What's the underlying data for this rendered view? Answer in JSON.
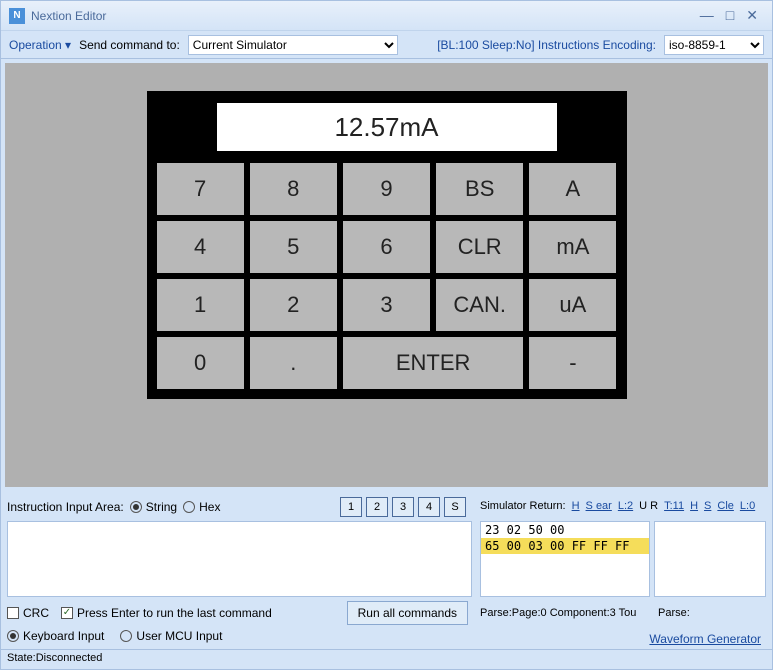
{
  "window": {
    "title": "Nextion Editor",
    "icon_text": "N"
  },
  "toolbar": {
    "operation": "Operation",
    "send_to_label": "Send command to:",
    "send_to_value": "Current Simulator",
    "bracket_info": "[BL:100 Sleep:No] Instructions Encoding:",
    "encoding_value": "iso-8859-1"
  },
  "calc": {
    "display": "12.57mA",
    "keys_row1": [
      "7",
      "8",
      "9",
      "BS",
      "A"
    ],
    "keys_row2": [
      "4",
      "5",
      "6",
      "CLR",
      "mA"
    ],
    "keys_row3": [
      "1",
      "2",
      "3",
      "CAN.",
      "uA"
    ],
    "keys_row4": [
      "0",
      ".",
      "ENTER",
      "-"
    ]
  },
  "input": {
    "label": "Instruction Input Area:",
    "radio_string": "String",
    "radio_hex": "Hex",
    "selected_radio": "string",
    "num_buttons": [
      "1",
      "2",
      "3",
      "4",
      "S"
    ],
    "textarea_value": ""
  },
  "return_panel": {
    "label": "Simulator Return:",
    "links": [
      "H",
      "S ear",
      "L:2",
      "U R",
      "T:11",
      "H",
      "S",
      "Cle",
      "L:0"
    ],
    "lines": [
      "23 02 50 00",
      "65 00 03 00 FF FF FF"
    ],
    "highlight_index": 1,
    "parse_a": "Parse:Page:0 Component:3 Tou",
    "parse_b": "Parse:"
  },
  "options": {
    "crc_label": "CRC",
    "press_enter_label": "Press Enter to run the last command",
    "crc_checked": false,
    "press_enter_checked": true,
    "run_all": "Run all commands",
    "keyboard_input": "Keyboard Input",
    "user_mcu": "User MCU Input",
    "input_mode": "keyboard",
    "waveform": "Waveform Generator"
  },
  "status": "State:Disconnected"
}
